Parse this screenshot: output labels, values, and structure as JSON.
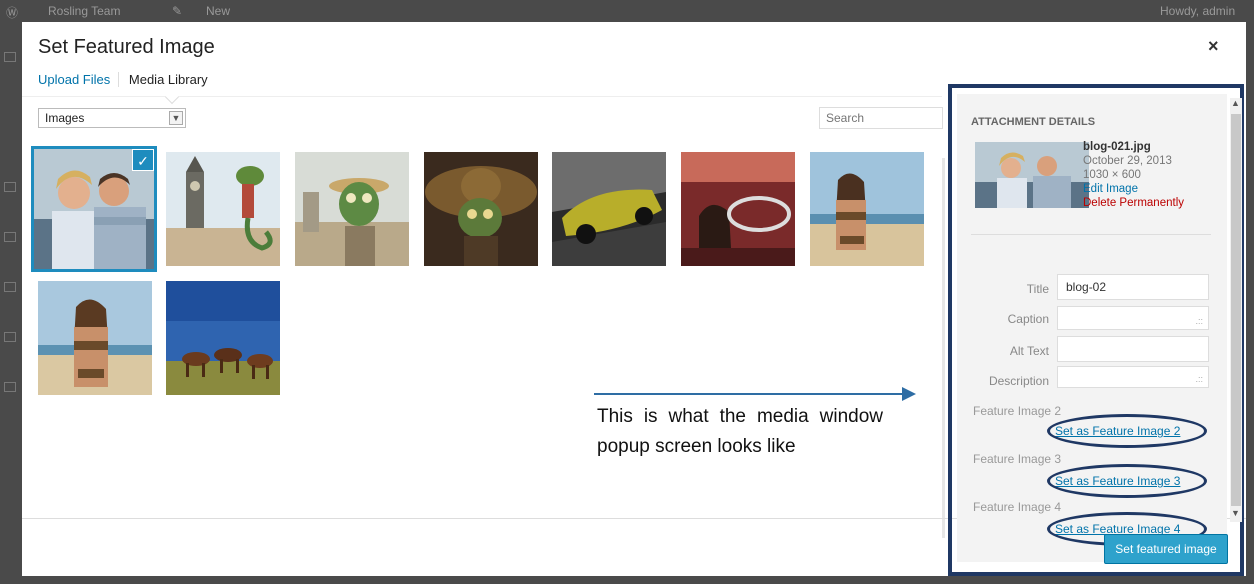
{
  "adminbar": {
    "site_name": "Rosling Team",
    "new_label": "New",
    "howdy": "Howdy, admin"
  },
  "modal": {
    "title": "Set Featured Image",
    "close_glyph": "×",
    "tabs": {
      "upload": "Upload Files",
      "library": "Media Library"
    },
    "filter": {
      "selected": "Images"
    },
    "search": {
      "placeholder": "Search"
    },
    "selected_index": 0
  },
  "annotation": {
    "text": "This is what the media window popup screen looks like"
  },
  "attachment_details": {
    "heading": "ATTACHMENT DETAILS",
    "filename": "blog-021.jpg",
    "date": "October 29, 2013",
    "dimensions": "1030 × 600",
    "edit_link": "Edit Image",
    "delete_link": "Delete Permanently",
    "fields": {
      "title_label": "Title",
      "title_value": "blog-02",
      "caption_label": "Caption",
      "alt_label": "Alt Text",
      "description_label": "Description"
    },
    "feature_images": [
      {
        "label": "Feature Image 2",
        "link": "Set as Feature Image 2"
      },
      {
        "label": "Feature Image 3",
        "link": "Set as Feature Image 3"
      },
      {
        "label": "Feature Image 4",
        "link": "Set as Feature Image 4"
      }
    ]
  },
  "footer": {
    "button": "Set featured image"
  },
  "icons": {
    "check": "checkmark-icon",
    "close": "close-icon",
    "select": "chevron-down-icon",
    "resize": "resize-icon"
  },
  "colors": {
    "accent": "#1e8cbe",
    "link": "#0073aa",
    "delete": "#bb0000",
    "annotation_frame": "#1f3864",
    "primary_button": "#2ea2cc"
  }
}
